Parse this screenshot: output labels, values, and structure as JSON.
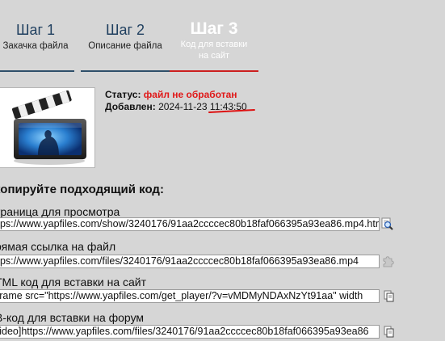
{
  "steps": [
    {
      "title": "Шаг 1",
      "caption": "Закачка файла"
    },
    {
      "title": "Шаг 2",
      "caption": "Описание файла"
    },
    {
      "title": "Шаг 3",
      "caption_line1": "Код для вставки",
      "caption_line2": "на сайт"
    }
  ],
  "file": {
    "status_label": "Статус:",
    "status_value": "файл не обработан",
    "added_label": "Добавлен:",
    "added_date": "2024-11-23",
    "added_time": "11:43:50"
  },
  "heading": "копируйте подходящий код:",
  "fields": [
    {
      "label": "траница для просмотра",
      "value": "ttps://www.yapfiles.com/show/3240176/91aa2ccccec80b18faf066395a93ea86.mp4.html",
      "icon": "magnifier-icon"
    },
    {
      "label": "рямая ссылка на файл",
      "value": "ttps://www.yapfiles.com/files/3240176/91aa2ccccec80b18faf066395a93ea86.mp4",
      "icon": "puzzle-icon"
    },
    {
      "label": "TML код для вставки на сайт",
      "value": "iframe src=\"https://www.yapfiles.com/get_player/?v=vMDMyNDAxNzYt91aa\" width",
      "icon": "copy-icon"
    },
    {
      "label": "B-код для вставки на форум",
      "value": "video]https://www.yapfiles.com/files/3240176/91aa2ccccec80b18faf066395a93ea86",
      "icon": "copy-icon"
    }
  ],
  "colors": {
    "accent_active": "#ffffff",
    "step_line_inactive": "#2e4f6a",
    "step_line_active": "#cc1f1f",
    "status_red": "#e01818"
  }
}
